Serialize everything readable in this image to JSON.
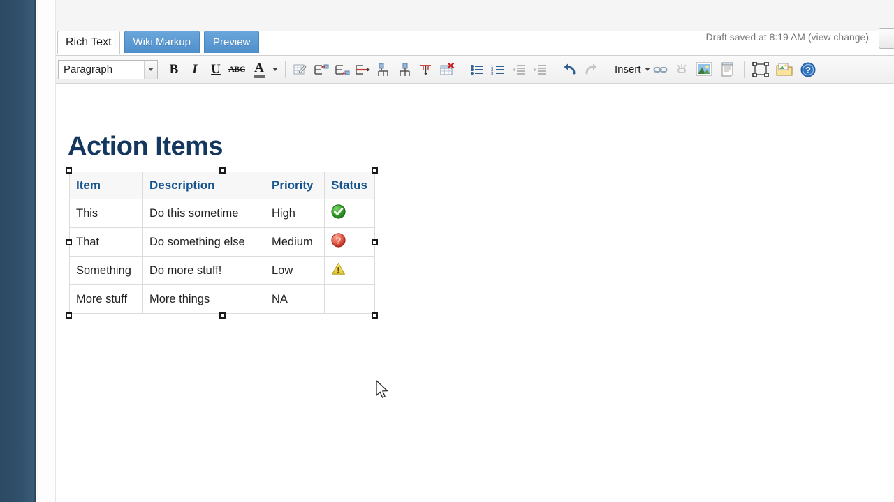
{
  "app": {
    "tabs": [
      {
        "label": "Rich Text",
        "active": true
      },
      {
        "label": "Wiki Markup",
        "active": false
      },
      {
        "label": "Preview",
        "active": false
      }
    ],
    "draft_status": "Draft saved at 8:19 AM (view change)"
  },
  "toolbar": {
    "style_select": {
      "value": "Paragraph"
    },
    "bold": "B",
    "italic": "I",
    "underline": "U",
    "strikethrough": "ABC",
    "text_color": "A",
    "insert_label": "Insert",
    "accent_color": "#16548e",
    "buttons": [
      "edit-table-icon",
      "insert-row-above-icon",
      "insert-row-below-icon",
      "insert-column-icon",
      "merge-cells-icon",
      "split-cells-icon",
      "delete-row-icon",
      "delete-table-icon",
      "bullet-list-icon",
      "numbered-list-icon",
      "outdent-icon",
      "indent-icon",
      "undo-icon",
      "redo-icon",
      "link-icon",
      "unlink-icon",
      "image-icon",
      "page-icon",
      "fullscreen-icon",
      "properties-icon",
      "help-icon"
    ]
  },
  "document": {
    "title": "Action Items",
    "title_color": "#14375f",
    "table": {
      "headers": [
        "Item",
        "Description",
        "Priority",
        "Status"
      ],
      "rows": [
        {
          "item": "This",
          "description": "Do this sometime",
          "priority": "High",
          "status_icon": "check-circle-icon",
          "status_color": "#2e9b2e"
        },
        {
          "item": "That",
          "description": "Do something else",
          "priority": "Medium",
          "status_icon": "question-circle-icon",
          "status_color": "#e05b4a"
        },
        {
          "item": "Something",
          "description": "Do more stuff!",
          "priority": "Low",
          "status_icon": "warning-triangle-icon",
          "status_color": "#e8d24a"
        },
        {
          "item": "More stuff",
          "description": "More things",
          "priority": "NA",
          "status_icon": "",
          "status_color": ""
        }
      ]
    }
  }
}
